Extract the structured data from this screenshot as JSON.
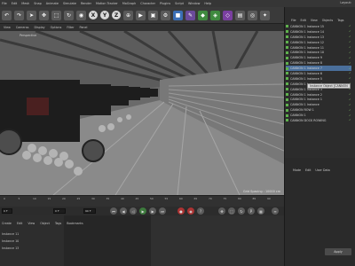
{
  "menubar": {
    "items": [
      "File",
      "Edit",
      "Mesh",
      "Snap",
      "Animate",
      "Simulate",
      "Render",
      "Motion Tracker",
      "MoGraph",
      "Character",
      "Plugins",
      "Script",
      "Window",
      "Help"
    ],
    "layout": "Layout:"
  },
  "toolbar": {
    "axis": [
      "X",
      "Y",
      "Z"
    ]
  },
  "viewport": {
    "menu": [
      "View",
      "Cameras",
      "Display",
      "Options",
      "Filter",
      "Panel"
    ],
    "camera_label": "Perspective",
    "grid_text": "Grid Spacing : 10000 cm"
  },
  "timeline": {
    "ticks": [
      "0",
      "5",
      "10",
      "15",
      "20",
      "25",
      "30",
      "35",
      "40",
      "45",
      "50",
      "55",
      "60",
      "65",
      "70",
      "75",
      "80",
      "85",
      "90"
    ],
    "field_left": "0 F",
    "field_mid": "0 F",
    "field_right": "90 F"
  },
  "bottom_left": {
    "menu": [
      "Create",
      "Edit",
      "View",
      "Object",
      "Tags",
      "Bookmarks"
    ],
    "items": [
      "Instance 11",
      "Instance 10",
      "Instance 13"
    ]
  },
  "object_manager": {
    "tabs": [
      "File",
      "Edit",
      "View",
      "Objects",
      "Tags"
    ],
    "items": [
      {
        "label": "CANNON 1 Instance 15",
        "selected": false
      },
      {
        "label": "CANNON 1 Instance 14",
        "selected": false
      },
      {
        "label": "CANNON 1 Instance 13",
        "selected": false
      },
      {
        "label": "CANNON 1 Instance 12",
        "selected": false
      },
      {
        "label": "CANNON 1 Instance 11",
        "selected": false
      },
      {
        "label": "CANNON 1 Instance 10",
        "selected": false
      },
      {
        "label": "CANNON 1 Instance 9",
        "selected": false
      },
      {
        "label": "CANNON 1 Instance 8",
        "selected": false
      },
      {
        "label": "CANNON 1 Instance 7",
        "selected": true
      },
      {
        "label": "CANNON 1 Instance 6",
        "selected": false
      },
      {
        "label": "CANNON 1 Instance 5",
        "selected": false
      },
      {
        "label": "CANNON 1 Instance 4",
        "selected": false
      },
      {
        "label": "CANNON 1 Instance 3",
        "selected": false
      },
      {
        "label": "CANNON 1 Instance 2",
        "selected": false
      },
      {
        "label": "CANNON 1 Instance 1",
        "selected": false
      },
      {
        "label": "CANNON 1 Instance",
        "selected": false
      },
      {
        "label": "CANNON ROW 1",
        "selected": false
      },
      {
        "label": "CANNON 1",
        "selected": false
      },
      {
        "label": "CANNON DOCK ROWING",
        "selected": false
      }
    ],
    "tooltip": "Instance Object [CANNON"
  },
  "attributes": {
    "tabs": [
      "Mode",
      "Edit",
      "User Data"
    ],
    "apply": "Apply"
  },
  "colors": {
    "accent": "#4a6f9b",
    "object_icon": "#5fb24d"
  }
}
